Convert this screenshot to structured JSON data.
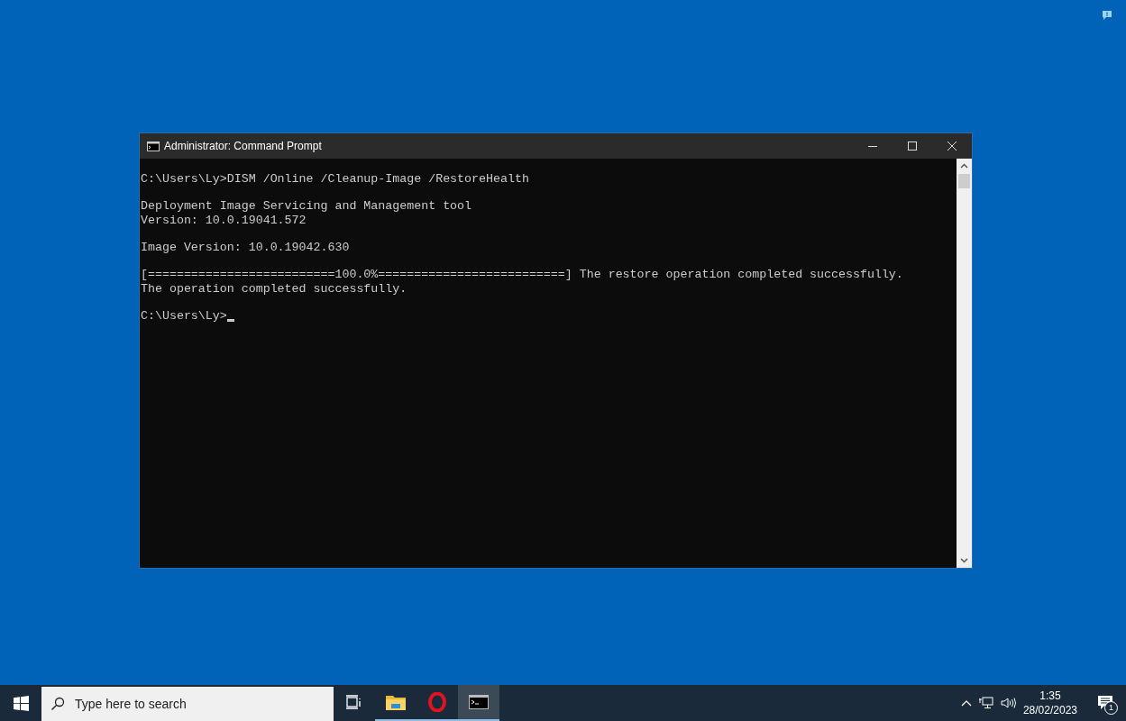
{
  "window": {
    "title": "Administrator: Command Prompt"
  },
  "console": {
    "blocks": [
      [
        "C:\\Users\\Ly>DISM /Online /Cleanup-Image /RestoreHealth"
      ],
      [
        "Deployment Image Servicing and Management tool",
        "Version: 10.0.19041.572"
      ],
      [
        "Image Version: 10.0.19042.630"
      ],
      [
        "[==========================100.0%==========================] The restore operation completed successfully.",
        "The operation completed successfully."
      ],
      [
        "C:\\Users\\Ly>"
      ]
    ]
  },
  "taskbar": {
    "search": {
      "placeholder": "Type here to search"
    },
    "apps": [
      {
        "kind": "taskview",
        "running": false,
        "selected": false
      },
      {
        "kind": "explorer",
        "running": true,
        "selected": false
      },
      {
        "kind": "opera",
        "running": true,
        "selected": false
      },
      {
        "kind": "terminal",
        "running": true,
        "selected": true
      }
    ],
    "clock": {
      "time": "1:35",
      "date": "28/02/2023"
    },
    "notifications": {
      "count": "1"
    }
  }
}
